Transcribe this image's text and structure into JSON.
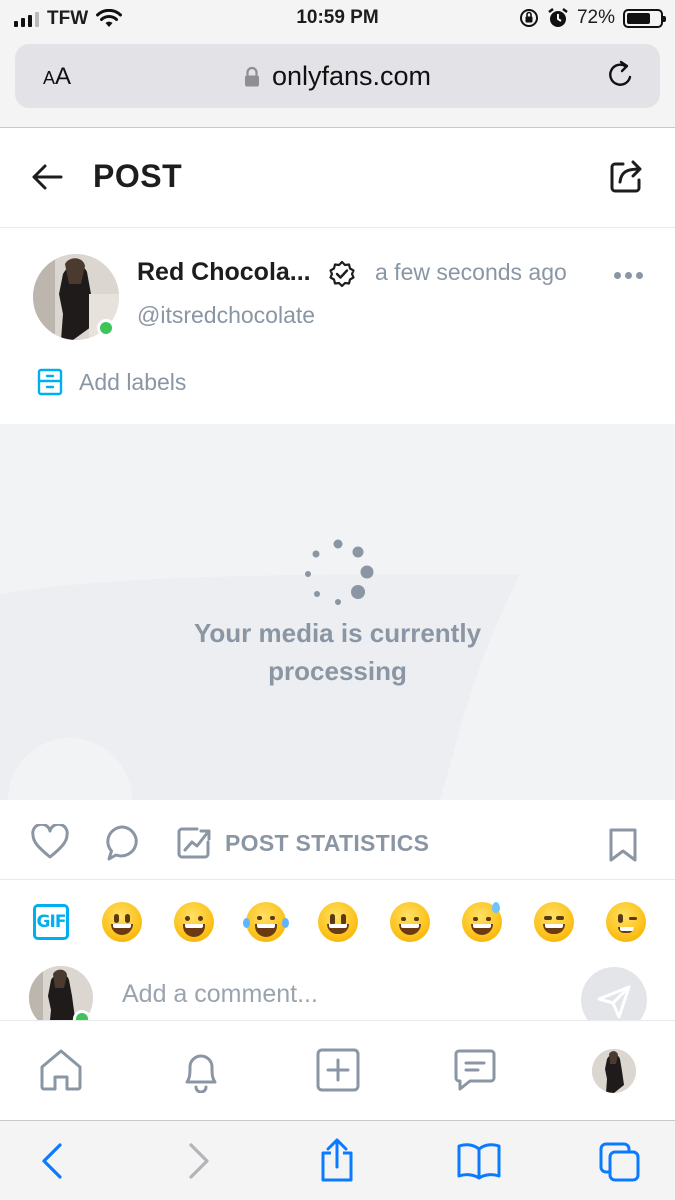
{
  "status_bar": {
    "carrier": "TFW",
    "time": "10:59 PM",
    "battery": "72%",
    "battery_level": 0.72
  },
  "browser": {
    "text_size_label_small": "A",
    "text_size_label_large": "A",
    "url": "onlyfans.com"
  },
  "header": {
    "title": "POST"
  },
  "post": {
    "author_name": "Red Chocola...",
    "time": "a few seconds ago",
    "username": "@itsredchocolate",
    "add_labels": "Add labels",
    "processing_line1": "Your media is currently",
    "processing_line2": "processing"
  },
  "actions": {
    "statistics_label": "POST STATISTICS"
  },
  "emoji_bar": {
    "gif_label": "GIF",
    "emojis": [
      "grinning-face",
      "beaming-face",
      "tears-of-joy",
      "smiling-face",
      "grinning-squinting",
      "sweat-smile",
      "squinting-face",
      "winking-face"
    ]
  },
  "comment": {
    "placeholder": "Add a comment..."
  },
  "colors": {
    "accent": "#00aff0",
    "muted": "#8a96a3",
    "online": "#3fc459",
    "ios_blue": "#0a7aff"
  }
}
